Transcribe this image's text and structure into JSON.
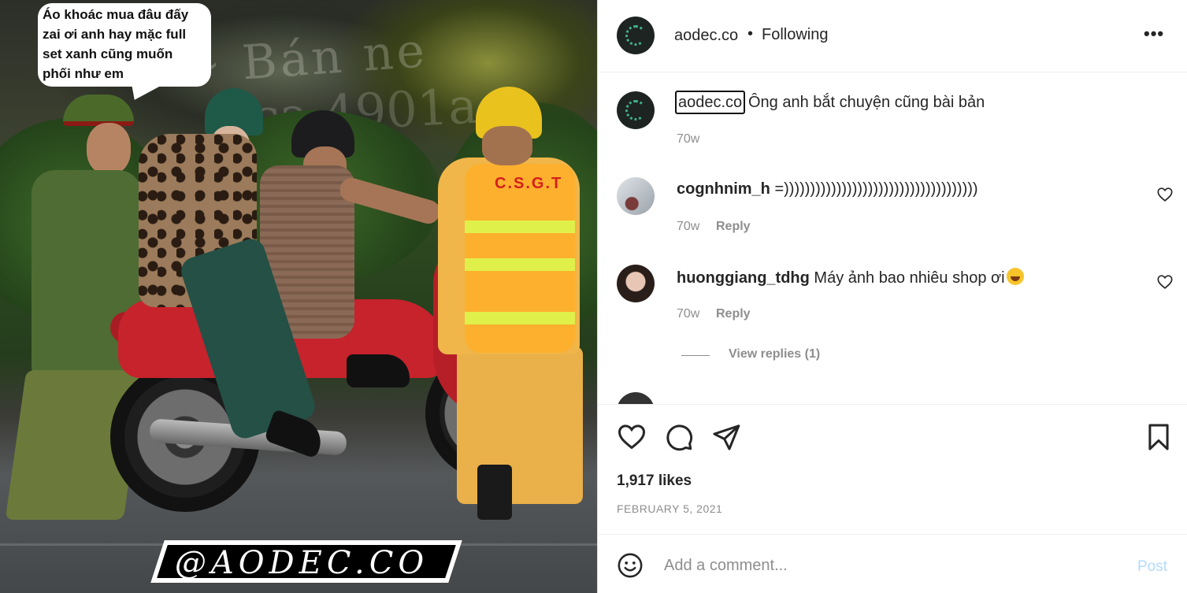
{
  "photo": {
    "speech_bubble": [
      "Áo khoác mua đâu đấy",
      "zai ơi anh hay mặc full",
      "set xanh cũng muốn",
      "phối như em"
    ],
    "vest_text": "C.S.G.T",
    "watermark": "@AODEC.CO"
  },
  "header": {
    "username": "aodec.co",
    "separator": "•",
    "follow_status": "Following",
    "more_icon": "more-horizontal-icon"
  },
  "caption": {
    "username": "aodec.co",
    "text": "Ông anh bắt chuyện cũng bài bản",
    "time": "70w"
  },
  "comments": [
    {
      "username": "cognhnim_h",
      "text": "=)))))))))))))))))))))))))))))))))))))",
      "time": "70w",
      "reply_label": "Reply"
    },
    {
      "username": "huonggiang_tdhg",
      "text": "Máy ảnh bao nhiêu shop ơi",
      "emoji": "rolling-on-floor-laughing-emoji",
      "time": "70w",
      "reply_label": "Reply"
    }
  ],
  "view_replies": "View replies (1)",
  "actions": {
    "icons": [
      "heart-icon",
      "comment-icon",
      "share-icon",
      "bookmark-icon"
    ],
    "likes": "1,917 likes",
    "date": "FEBRUARY 5, 2021"
  },
  "composer": {
    "placeholder": "Add a comment...",
    "post_label": "Post"
  },
  "colors": {
    "text": "#262626",
    "secondary": "#8e8e8e",
    "post_disabled": "#b3dbff",
    "divider": "#efefef"
  }
}
